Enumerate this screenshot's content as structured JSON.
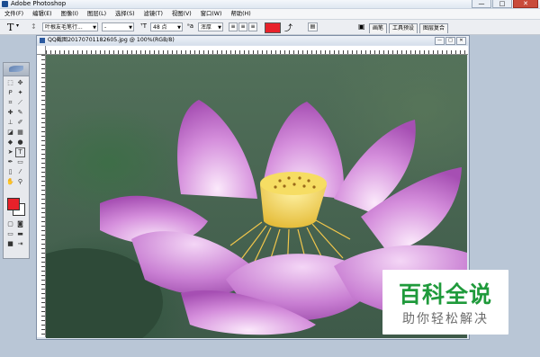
{
  "app": {
    "title": "Adobe Photoshop",
    "window_controls": [
      "—",
      "□",
      "✕"
    ]
  },
  "menu": [
    "文件(F)",
    "编辑(E)",
    "图像(I)",
    "图层(L)",
    "选择(S)",
    "滤镜(T)",
    "视图(V)",
    "窗口(W)",
    "帮助(H)"
  ],
  "options_bar": {
    "tool_glyph": "T",
    "font_family": "叶根友毛笔行...",
    "font_style": "-",
    "font_size": "48 点",
    "antialias": "浑厚",
    "text_color": "#e8212a"
  },
  "palette_tabs": [
    "画笔",
    "工具预设",
    "图层复合"
  ],
  "document": {
    "title": "QQ截图20170701182605.jpg @ 100%(RGB/8)"
  },
  "tools": {
    "foreground_color": "#e8212a",
    "background_color": "#ffffff",
    "icons": [
      "marquee-icon",
      "move-icon",
      "lasso-icon",
      "magic-wand-icon",
      "crop-icon",
      "slice-icon",
      "healing-brush-icon",
      "brush-icon",
      "clone-stamp-icon",
      "history-brush-icon",
      "eraser-icon",
      "gradient-icon",
      "blur-icon",
      "dodge-icon",
      "path-select-icon",
      "type-icon",
      "pen-icon",
      "shape-icon",
      "notes-icon",
      "eyedropper-icon",
      "hand-icon",
      "zoom-icon"
    ]
  },
  "watermark": {
    "title": "百科全说",
    "subtitle": "助你轻松解决"
  }
}
